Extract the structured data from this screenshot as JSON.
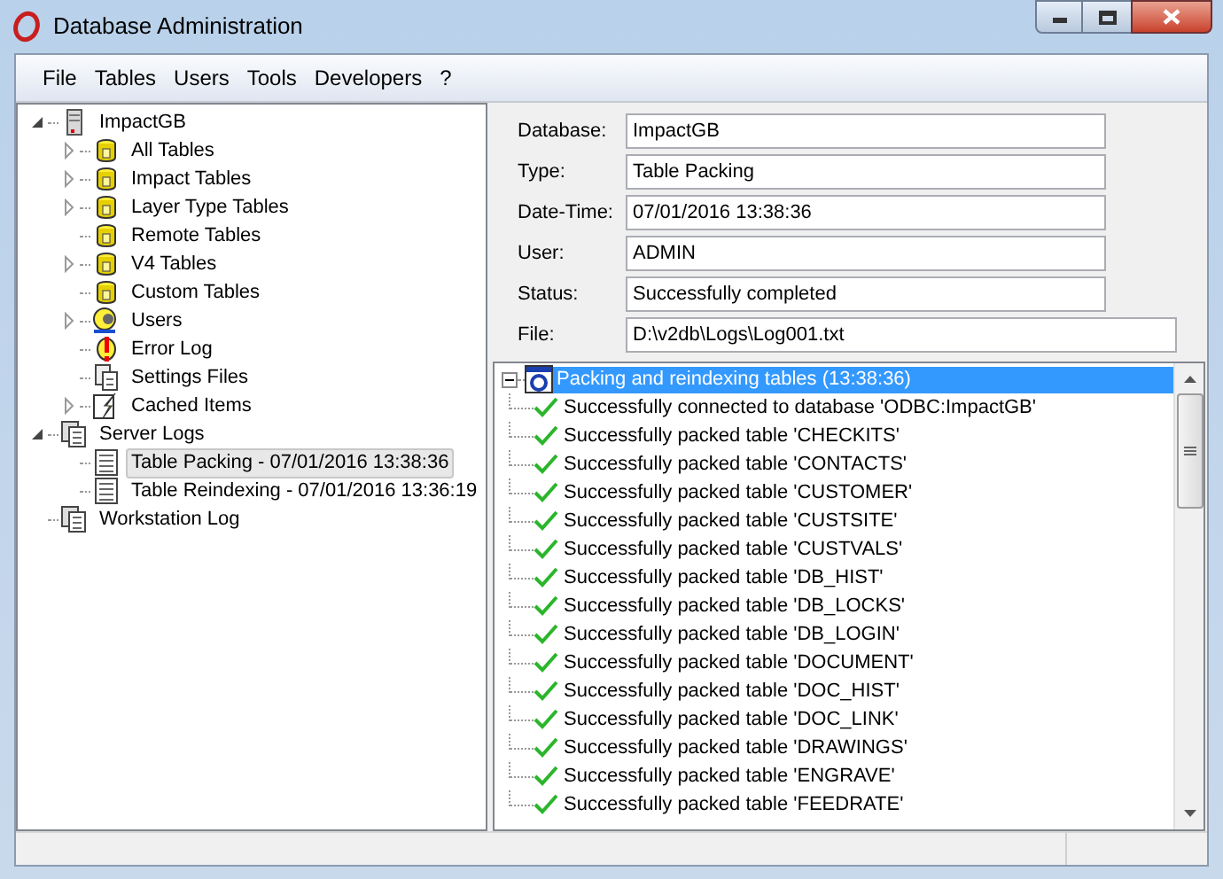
{
  "window": {
    "title": "Database Administration"
  },
  "menu": [
    "File",
    "Tables",
    "Users",
    "Tools",
    "Developers",
    "?"
  ],
  "tree": [
    {
      "label": "ImpactGB",
      "kind": "server",
      "expanded": true,
      "selected": false,
      "children": [
        {
          "label": "All Tables",
          "kind": "database",
          "expanded": false,
          "selected": false
        },
        {
          "label": "Impact Tables",
          "kind": "database",
          "expanded": false,
          "selected": false
        },
        {
          "label": "Layer Type Tables",
          "kind": "database",
          "expanded": false,
          "selected": false
        },
        {
          "label": "Remote Tables",
          "kind": "database",
          "selected": false
        },
        {
          "label": "V4 Tables",
          "kind": "database",
          "expanded": false,
          "selected": false
        },
        {
          "label": "Custom Tables",
          "kind": "database",
          "selected": false
        },
        {
          "label": "Users",
          "kind": "users",
          "expanded": false,
          "selected": false
        },
        {
          "label": "Error Log",
          "kind": "error",
          "selected": false
        },
        {
          "label": "Settings Files",
          "kind": "files",
          "selected": false
        },
        {
          "label": "Cached Items",
          "kind": "cached",
          "expanded": false,
          "selected": false
        }
      ]
    },
    {
      "label": "Server Logs",
      "kind": "logs",
      "expanded": true,
      "selected": false,
      "children": [
        {
          "label": "Table Packing - 07/01/2016 13:38:36",
          "kind": "log",
          "selected": true
        },
        {
          "label": "Table Reindexing - 07/01/2016 13:36:19",
          "kind": "log",
          "selected": false
        }
      ]
    },
    {
      "label": "Workstation Log",
      "kind": "logs",
      "selected": false
    }
  ],
  "details": [
    {
      "label": "Database:",
      "value": "ImpactGB"
    },
    {
      "label": "Type:",
      "value": "Table Packing"
    },
    {
      "label": "Date-Time:",
      "value": "07/01/2016 13:38:36"
    },
    {
      "label": "User:",
      "value": "ADMIN"
    },
    {
      "label": "Status:",
      "value": "Successfully completed"
    },
    {
      "label": "File:",
      "value": "D:\\v2db\\Logs\\Log001.txt"
    }
  ],
  "log": {
    "header": "Packing and reindexing tables (13:38:36)",
    "expanded": true,
    "selected": true,
    "entries": [
      "Successfully connected to database 'ODBC:ImpactGB'",
      "Successfully packed table 'CHECKITS'",
      "Successfully packed table 'CONTACTS'",
      "Successfully packed table 'CUSTOMER'",
      "Successfully packed table 'CUSTSITE'",
      "Successfully packed table 'CUSTVALS'",
      "Successfully packed table 'DB_HIST'",
      "Successfully packed table 'DB_LOCKS'",
      "Successfully packed table 'DB_LOGIN'",
      "Successfully packed table 'DOCUMENT'",
      "Successfully packed table 'DOC_HIST'",
      "Successfully packed table 'DOC_LINK'",
      "Successfully packed table 'DRAWINGS'",
      "Successfully packed table 'ENGRAVE'",
      "Successfully packed table 'FEEDRATE'"
    ]
  }
}
